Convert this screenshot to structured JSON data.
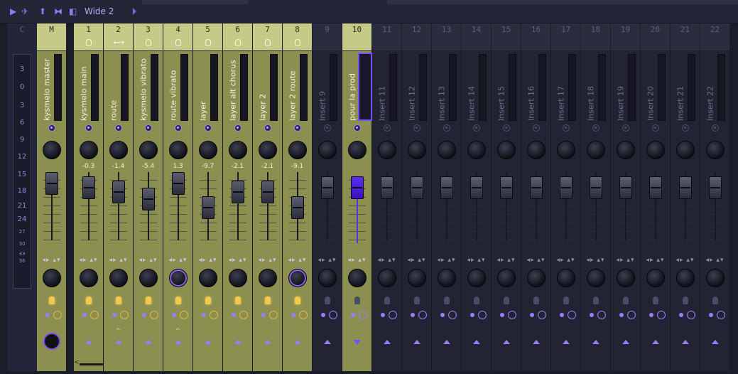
{
  "toolbar": {
    "title": "Wide 2"
  },
  "current": {
    "label": "C"
  },
  "scale": [
    "3",
    "0",
    "3",
    "6",
    "9",
    "12",
    "15",
    "18",
    "21",
    "24",
    "27",
    "30",
    "33",
    "36"
  ],
  "strips": [
    {
      "num": "M",
      "name": "kysmelo master",
      "active": true,
      "val": ""
    },
    {
      "num": "1",
      "name": "kysmelo main",
      "active": true,
      "val": "-0.3"
    },
    {
      "num": "2",
      "name": "route",
      "active": true,
      "val": "-1.4"
    },
    {
      "num": "3",
      "name": "kysmelo vibrato",
      "active": true,
      "val": "-5.4"
    },
    {
      "num": "4",
      "name": "route vibrato",
      "active": true,
      "val": "1.3"
    },
    {
      "num": "5",
      "name": "layer",
      "active": true,
      "val": "-9.7"
    },
    {
      "num": "6",
      "name": "layer alt chorus",
      "active": true,
      "val": "-2.1"
    },
    {
      "num": "7",
      "name": "layer 2",
      "active": true,
      "val": "-2.1"
    },
    {
      "num": "8",
      "name": "layer 2 route",
      "active": true,
      "val": "-9.1"
    },
    {
      "num": "9",
      "name": "Insert 9",
      "active": false,
      "val": ""
    },
    {
      "num": "10",
      "name": "pour la prod",
      "active": true,
      "val": ""
    },
    {
      "num": "11",
      "name": "Insert 11",
      "active": false,
      "val": ""
    },
    {
      "num": "12",
      "name": "Insert 12",
      "active": false,
      "val": ""
    },
    {
      "num": "13",
      "name": "Insert 13",
      "active": false,
      "val": ""
    },
    {
      "num": "14",
      "name": "Insert 14",
      "active": false,
      "val": ""
    },
    {
      "num": "15",
      "name": "Insert 15",
      "active": false,
      "val": ""
    },
    {
      "num": "16",
      "name": "Insert 16",
      "active": false,
      "val": ""
    },
    {
      "num": "17",
      "name": "Insert 17",
      "active": false,
      "val": ""
    },
    {
      "num": "18",
      "name": "Insert 18",
      "active": false,
      "val": ""
    },
    {
      "num": "19",
      "name": "Insert 19",
      "active": false,
      "val": ""
    },
    {
      "num": "20",
      "name": "Insert 20",
      "active": false,
      "val": ""
    },
    {
      "num": "21",
      "name": "Insert 21",
      "active": false,
      "val": ""
    },
    {
      "num": "22",
      "name": "Insert 22",
      "active": false,
      "val": ""
    }
  ],
  "colors": {
    "accent": "#7a4dff",
    "active_strip": "#8b9050",
    "header_active": "#c5cb86"
  }
}
